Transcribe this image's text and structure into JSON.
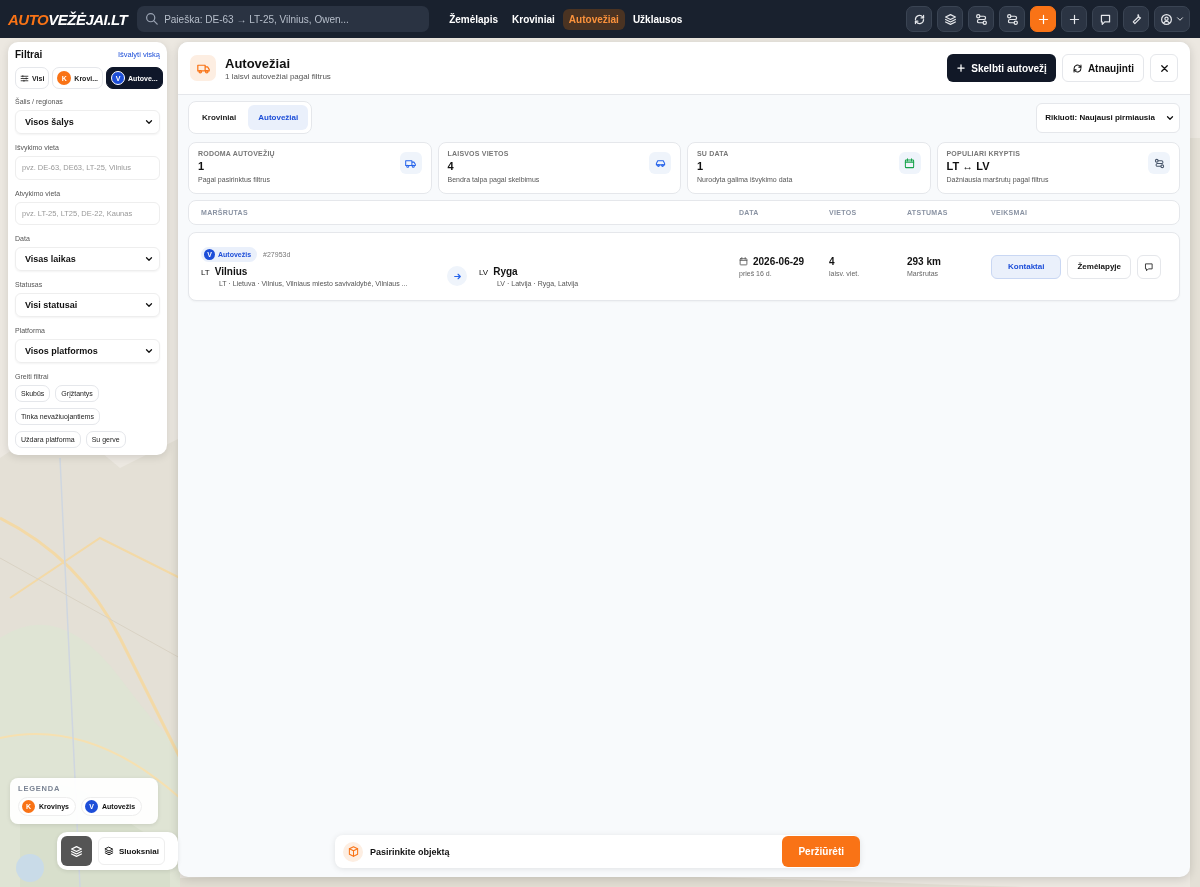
{
  "header": {
    "logo": {
      "accent": "AUTO",
      "rest": "VEŽĖJAI.LT"
    },
    "search": {
      "placeholder": "Paieška: DE-63 → LT-25, Vilnius, Owen..."
    },
    "nav": [
      {
        "label": "Žemėlapis",
        "selected": false
      },
      {
        "label": "Kroviniai",
        "selected": false
      },
      {
        "label": "Autovežiai",
        "selected": true
      },
      {
        "label": "Užklausos",
        "selected": false
      }
    ],
    "toolbar": [
      {
        "kind": "refresh"
      },
      {
        "kind": "layers"
      },
      {
        "kind": "route"
      },
      {
        "kind": "route"
      },
      {
        "kind": "create"
      },
      {
        "kind": "add"
      },
      {
        "kind": "chat"
      },
      {
        "kind": "tools"
      },
      {
        "kind": "account"
      }
    ]
  },
  "filters": {
    "title": "Filtrai",
    "clear": "Išvalyti viską",
    "types": [
      {
        "kind": "all",
        "label": "Visi",
        "selected": false
      },
      {
        "kind": "badge",
        "badge": "K",
        "color": "#f97316",
        "label": "Krovi...",
        "selected": false
      },
      {
        "kind": "badge",
        "badge": "V",
        "color": "#1d4ed8",
        "label": "Autove...",
        "selected": true
      }
    ],
    "fields": [
      {
        "kind": "select",
        "label": "Šalis / regionas",
        "value": "Visos šalys"
      },
      {
        "kind": "input",
        "label": "Išvykimo vieta",
        "placeholder": "pvz. DE-63, DE63, LT-25, Vilnius"
      },
      {
        "kind": "input",
        "label": "Atvykimo vieta",
        "placeholder": "pvz. LT-25, LT25, DE-22, Kaunas"
      },
      {
        "kind": "select",
        "label": "Data",
        "value": "Visas laikas"
      },
      {
        "kind": "select",
        "label": "Statusas",
        "value": "Visi statusai"
      },
      {
        "kind": "select",
        "label": "Platforma",
        "value": "Visos platformos"
      }
    ],
    "quick": {
      "label": "Greiti filtrai",
      "chips": [
        "Skubūs",
        "Grįžtantys",
        "Tinka nevažiuojantiems",
        "Uždara platforma",
        "Su gerve"
      ]
    }
  },
  "panel": {
    "title": "Autovežiai",
    "subtitle": "1 laisvi autovežiai pagal filtrus",
    "post_button": "Skelbti autovežį",
    "refresh_button": "Atnaujinti",
    "tabs": [
      {
        "label": "Kroviniai",
        "selected": false
      },
      {
        "label": "Autovežiai",
        "selected": true
      }
    ],
    "sort": {
      "value": "Rikiuoti: Naujausi pirmiausia"
    },
    "stats": [
      {
        "kind": "count",
        "label": "RODOMA AUTOVEŽIŲ",
        "value": "1",
        "note": "Pagal pasirinktus filtrus"
      },
      {
        "kind": "seats",
        "label": "LAISVOS VIETOS",
        "value": "4",
        "note": "Bendra talpa pagal skelbimus"
      },
      {
        "kind": "date",
        "label": "SU DATA",
        "value": "1",
        "note": "Nurodyta galima išvykimo data"
      },
      {
        "kind": "direction",
        "label": "POPULIARI KRYPTIS",
        "value": "LT ↔ LV",
        "note": "Dažniausia maršrutų pagal filtrus"
      }
    ],
    "table": {
      "columns": [
        "MARŠRUTAS",
        "DATA",
        "VIETOS",
        "ATSTUMAS",
        "VEIKSMAI"
      ],
      "rows": [
        {
          "badge": "V",
          "type": "Autovežis",
          "id": "#27953d",
          "from_code": "LT",
          "from": "Vilnius",
          "from_detail": "LT · Lietuva · Vilnius, Vilniaus miesto savivaldybė, Vilniaus ...",
          "to_code": "LV",
          "to": "Ryga",
          "to_detail": "LV · Latvija · Ryga, Latvija",
          "date": "2026-06-29",
          "date_note": "prieš 16 d.",
          "seats": "4",
          "seats_note": "laisv. viet.",
          "distance": "293 km",
          "distance_note": "Maršrutas",
          "contact": "Kontaktai",
          "map": "Žemėlapyje"
        }
      ]
    },
    "selection": {
      "text": "Pasirinkite objektą",
      "button": "Peržiūrėti"
    }
  },
  "legend": {
    "title": "LEGENDA",
    "items": [
      {
        "badge": "K",
        "label": "Krovinys",
        "color": "#f97316"
      },
      {
        "badge": "V",
        "label": "Autovežis",
        "color": "#1d4ed8"
      }
    ]
  },
  "layers": {
    "label": "Sluoksniai"
  }
}
